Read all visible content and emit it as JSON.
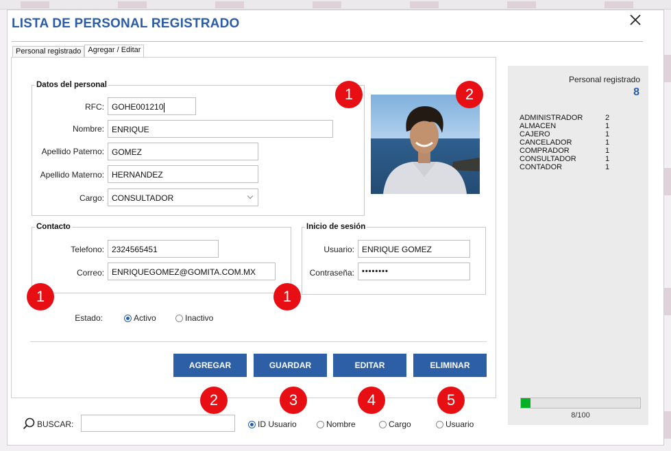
{
  "window": {
    "title": "LISTA DE PERSONAL REGISTRADO",
    "close_icon": "close-icon"
  },
  "tabs": [
    {
      "label": "Personal registrado",
      "active": false
    },
    {
      "label": "Agregar / Editar",
      "active": true
    }
  ],
  "datos": {
    "legend": "Datos del personal",
    "rfc_label": "RFC:",
    "rfc_value": "GOHE001210",
    "nombre_label": "Nombre:",
    "nombre_value": "ENRIQUE",
    "ap_paterno_label": "Apellido Paterno:",
    "ap_paterno_value": "GOMEZ",
    "ap_materno_label": "Apellido Materno:",
    "ap_materno_value": "HERNANDEZ",
    "cargo_label": "Cargo:",
    "cargo_value": "CONSULTADOR"
  },
  "contacto": {
    "legend": "Contacto",
    "telefono_label": "Telefono:",
    "telefono_value": "2324565451",
    "correo_label": "Correo:",
    "correo_value": "ENRIQUEGOMEZ@GOMITA.COM.MX"
  },
  "sesion": {
    "legend": "Inicio de sesión",
    "usuario_label": "Usuario:",
    "usuario_value": "ENRIQUE GOMEZ",
    "contrasena_label": "Contraseña:",
    "contrasena_value": "••••••••"
  },
  "estado": {
    "label": "Estado:",
    "options": [
      "Activo",
      "Inactivo"
    ],
    "selected": "Activo"
  },
  "buttons": {
    "agregar": "AGREGAR",
    "guardar": "GUARDAR",
    "editar": "EDITAR",
    "eliminar": "ELIMINAR"
  },
  "badges": [
    "1",
    "2",
    "1",
    "1",
    "2",
    "3",
    "4",
    "5"
  ],
  "search": {
    "label": "BUSCAR:",
    "value": "",
    "options": [
      "ID Usuario",
      "Nombre",
      "Cargo",
      "Usuario"
    ],
    "selected": "ID Usuario"
  },
  "summary": {
    "label": "Personal registrado",
    "count": "8",
    "roles": [
      {
        "name": "ADMINISTRADOR",
        "count": "2"
      },
      {
        "name": "ALMACEN",
        "count": "1"
      },
      {
        "name": "CAJERO",
        "count": "1"
      },
      {
        "name": "CANCELADOR",
        "count": "1"
      },
      {
        "name": "COMPRADOR",
        "count": "1"
      },
      {
        "name": "CONSULTADOR",
        "count": "1"
      },
      {
        "name": "CONTADOR",
        "count": "1"
      }
    ],
    "progress_text": "8/100",
    "progress_fraction": 0.08
  },
  "colors": {
    "accent": "#2b5ca8",
    "button": "#2d5fa6",
    "badge": "#e80f14",
    "progress": "#06b025"
  }
}
